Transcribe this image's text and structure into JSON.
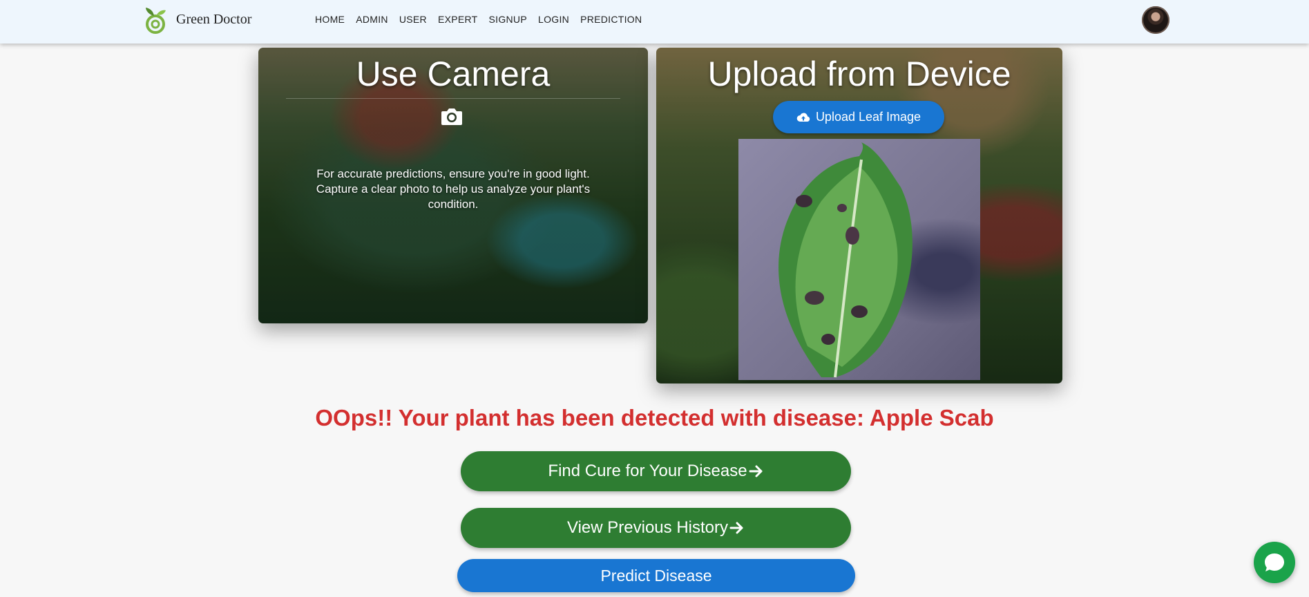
{
  "brand": {
    "name": "Green Doctor"
  },
  "nav": {
    "items": [
      "HOME",
      "ADMIN",
      "USER",
      "EXPERT",
      "SIGNUP",
      "LOGIN",
      "PREDICTION"
    ]
  },
  "camera_card": {
    "title": "Use Camera",
    "description": "For accurate predictions, ensure you're in good light. Capture a clear photo to help us analyze your plant's condition."
  },
  "upload_card": {
    "title": "Upload from Device",
    "upload_label": "Upload Leaf Image"
  },
  "result": {
    "message": "OOps!! Your plant has been detected with disease: Apple Scab"
  },
  "actions": {
    "find_cure": "Find Cure for Your Disease",
    "view_history": "View Previous History",
    "predict": "Predict Disease"
  },
  "colors": {
    "primary_green": "#2e7d32",
    "primary_blue": "#1976d2",
    "alert_red": "#d32f2f",
    "chat_green": "#1aa34a"
  },
  "icons": [
    "sprout-logo-icon",
    "camera-icon",
    "cloud-upload-icon",
    "arrow-right-icon",
    "chat-bubble-icon"
  ]
}
